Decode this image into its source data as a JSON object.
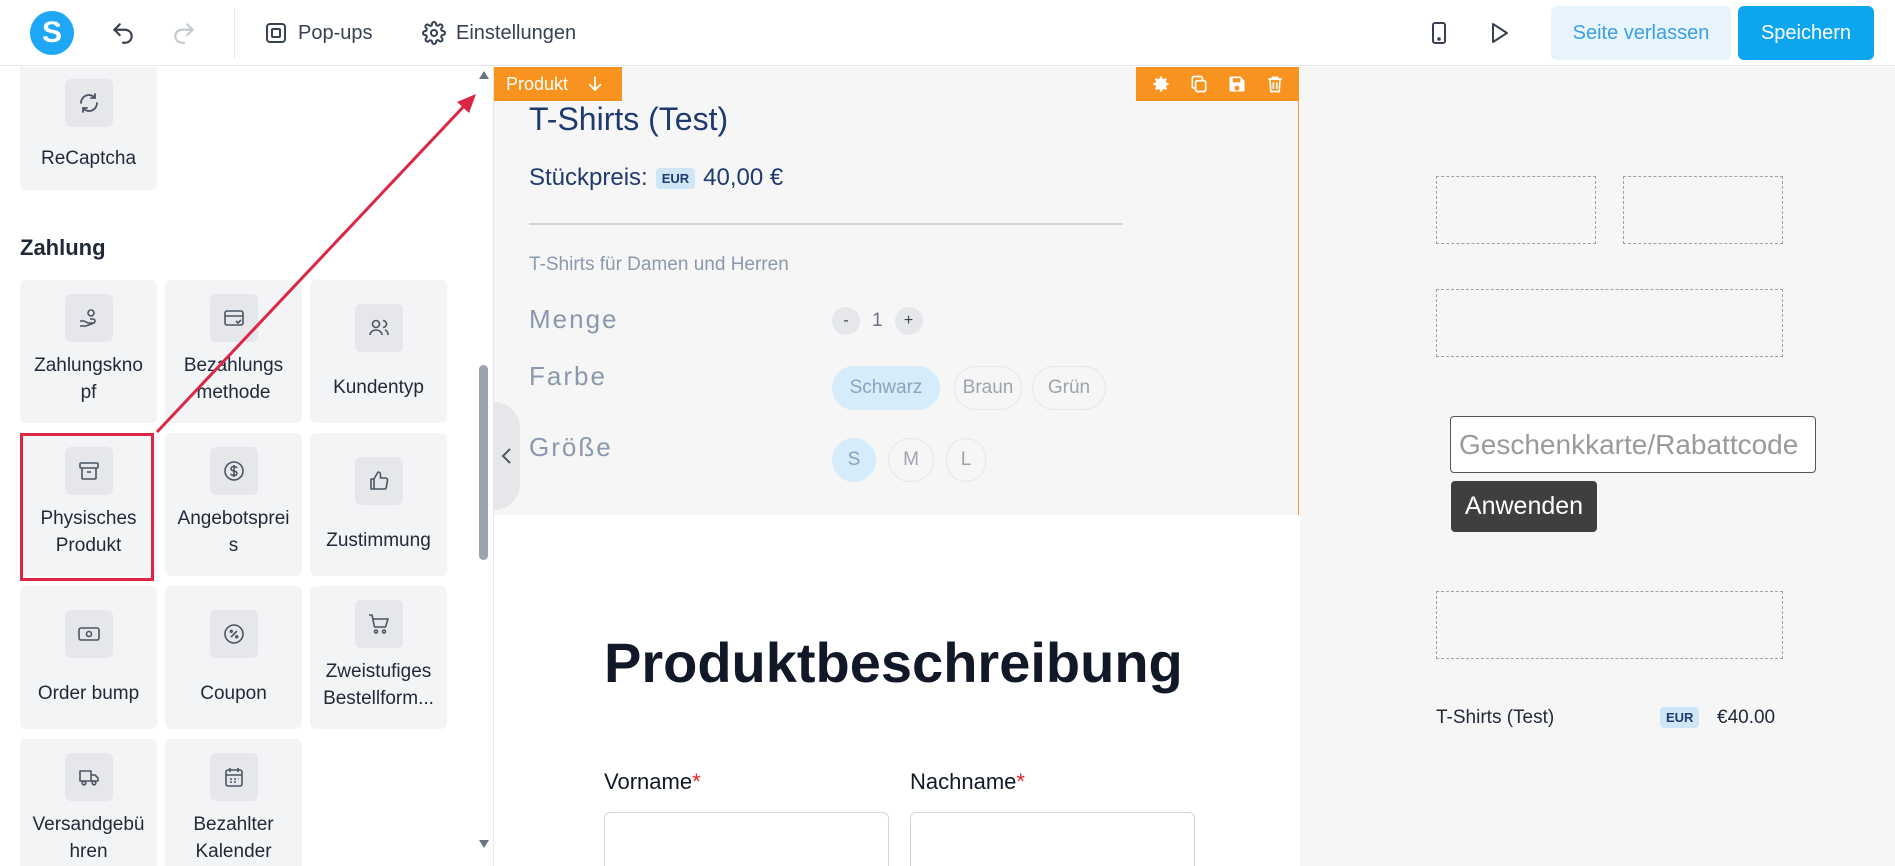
{
  "topbar": {
    "logo_letter": "S",
    "popups_label": "Pop-ups",
    "settings_label": "Einstellungen",
    "leave_label": "Seite verlassen",
    "save_label": "Speichern"
  },
  "sidebar": {
    "top_tile": {
      "label": "ReCaptcha",
      "icon": "refresh-icon"
    },
    "section_title": "Zahlung",
    "tiles": [
      {
        "label": "Zahlungskno\npf",
        "icon": "hand-coins-icon"
      },
      {
        "label": "Bezahlungs\nmethode",
        "icon": "credit-card-icon"
      },
      {
        "label": "Kundentyp",
        "icon": "users-icon"
      },
      {
        "label": "Physisches\nProdukt",
        "icon": "archive-box-icon"
      },
      {
        "label": "Angebotsprei\ns",
        "icon": "dollar-circle-icon"
      },
      {
        "label": "Zustimmung",
        "icon": "thumbs-up-icon"
      },
      {
        "label": "Order bump",
        "icon": "banknote-icon"
      },
      {
        "label": "Coupon",
        "icon": "percent-badge-icon"
      },
      {
        "label": "Zweistufiges\nBestellform...",
        "icon": "cart-icon"
      },
      {
        "label": "Versandgebü\nhren",
        "icon": "truck-icon"
      },
      {
        "label": "Bezahlter\nKalender",
        "icon": "calendar-icon"
      }
    ]
  },
  "canvas": {
    "block_tag": "Produkt",
    "product_title": "T-Shirts (Test)",
    "price_label": "Stückpreis:",
    "currency": "EUR",
    "price_value": "40,00 €",
    "description": "T-Shirts für Damen und Herren",
    "qty_label": "Menge",
    "qty_minus": "-",
    "qty_value": "1",
    "qty_plus": "+",
    "color_label": "Farbe",
    "colors": [
      "Schwarz",
      "Braun",
      "Grün"
    ],
    "size_label": "Größe",
    "sizes": [
      "S",
      "M",
      "L"
    ],
    "desc_heading": "Produktbeschreibung",
    "first_name_label": "Vorname",
    "last_name_label": "Nachname",
    "required_mark": "*"
  },
  "right_panel": {
    "coupon_placeholder": "Geschenkkarte/Rabattcode",
    "apply_label": "Anwenden",
    "summary_name": "T-Shirts (Test)",
    "summary_currency": "EUR",
    "summary_price": "€40.00"
  },
  "colors": {
    "accent": "#0ea5ef",
    "block_orange": "#f7931e",
    "highlight_red": "#dc2645"
  }
}
